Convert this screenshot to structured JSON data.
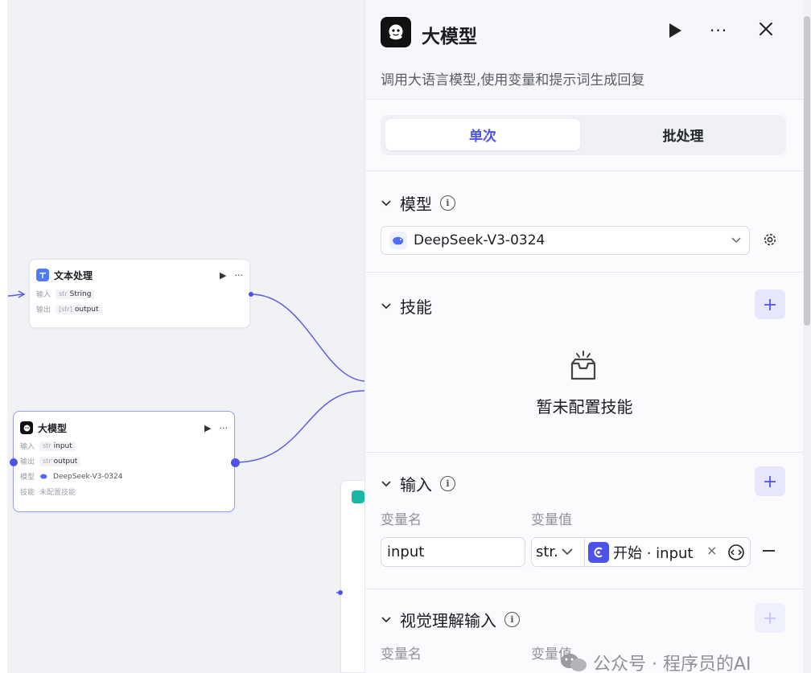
{
  "canvas": {
    "nodes": [
      {
        "title": "文本处理",
        "rows": [
          {
            "label": "输入",
            "type": "str",
            "value": "String"
          },
          {
            "label": "输出",
            "type": "[str]",
            "value": "output"
          }
        ]
      },
      {
        "title": "大模型",
        "rows": [
          {
            "label": "输入",
            "type": "str",
            "value": "input"
          },
          {
            "label": "输出",
            "type": "str",
            "value": "output"
          },
          {
            "label": "模型",
            "value": "DeepSeek-V3-0324"
          },
          {
            "label": "技能",
            "value": "未配置技能"
          }
        ]
      }
    ]
  },
  "panel": {
    "title": "大模型",
    "description": "调用大语言模型,使用变量和提示词生成回复",
    "tabs": [
      "单次",
      "批处理"
    ],
    "active_tab": "单次",
    "model_section": {
      "title": "模型",
      "selected_model": "DeepSeek-V3-0324"
    },
    "skills_section": {
      "title": "技能",
      "empty_text": "暂未配置技能"
    },
    "input_section": {
      "title": "输入",
      "col_name": "变量名",
      "col_value": "变量值",
      "rows": [
        {
          "name": "input",
          "type": "str.",
          "ref": "开始 · input"
        }
      ]
    },
    "vision_section": {
      "title": "视觉理解输入",
      "col_name": "变量名",
      "col_value": "变量值"
    }
  },
  "watermark": "公众号 · 程序员的AI",
  "colors": {
    "accent": "#4d53e8",
    "edge": "#5a5fe6"
  }
}
